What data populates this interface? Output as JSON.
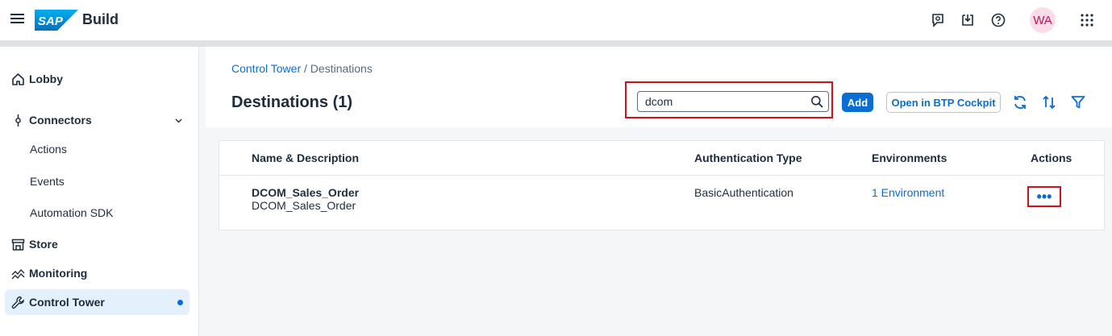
{
  "shell": {
    "logo_text": "SAP",
    "product": "Build",
    "avatar_initials": "WA",
    "icons": [
      "feedback-icon",
      "inbox-download-icon",
      "help-icon",
      "grid-menu-icon"
    ]
  },
  "sidebar": {
    "items": [
      {
        "label": "Lobby",
        "icon": "home-icon"
      },
      {
        "label": "Connectors",
        "icon": "connector-icon"
      },
      {
        "label": "Actions"
      },
      {
        "label": "Events"
      },
      {
        "label": "Automation SDK"
      },
      {
        "label": "Store",
        "icon": "store-icon"
      },
      {
        "label": "Monitoring",
        "icon": "monitoring-icon"
      },
      {
        "label": "Control Tower",
        "icon": "wrench-icon"
      }
    ]
  },
  "breadcrumb": {
    "parent": "Control Tower",
    "separator": "/",
    "current": "Destinations"
  },
  "page": {
    "title": "Destinations (1)"
  },
  "search": {
    "value": "dcom"
  },
  "toolbar": {
    "add_label": "Add",
    "btp_label": "Open in BTP Cockpit"
  },
  "table": {
    "columns": [
      "Name & Description",
      "Authentication Type",
      "Environments",
      "Actions"
    ],
    "rows": [
      {
        "name": "DCOM_Sales_Order",
        "description": "DCOM_Sales_Order",
        "auth": "BasicAuthentication",
        "environments": "1 Environment",
        "actions": "•••"
      }
    ]
  },
  "colors": {
    "accent": "#0a6ed1",
    "highlight": "#d0101c",
    "active_nav_bg": "#e4f1fc"
  }
}
